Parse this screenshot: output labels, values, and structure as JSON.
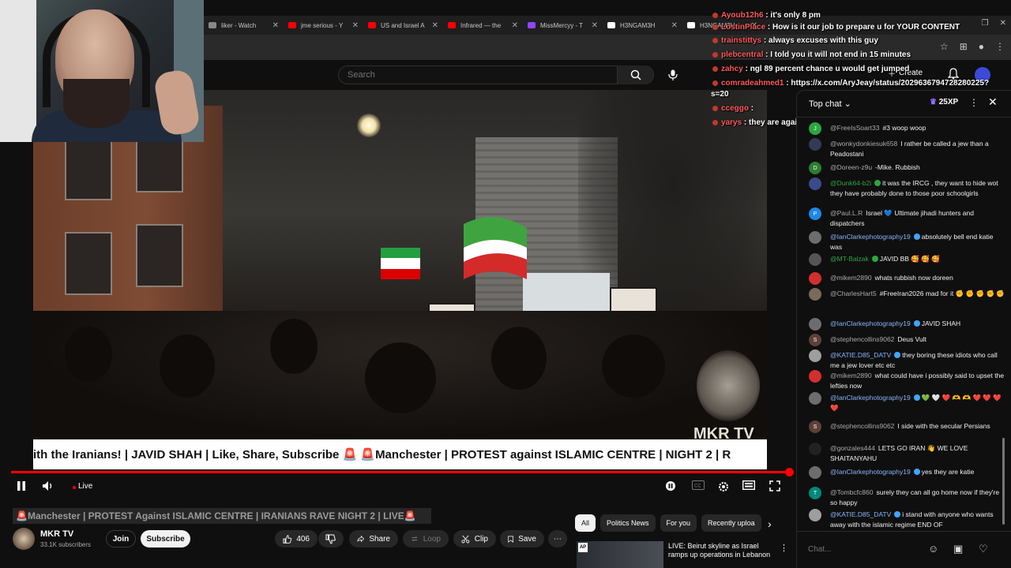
{
  "browser": {
    "tabs": [
      {
        "label": "liker - Watch",
        "color": "#888888"
      },
      {
        "label": "jme serious - Y",
        "color": "#ff0000"
      },
      {
        "label": "US and Israel A",
        "color": "#ff0000"
      },
      {
        "label": "Infrared — the",
        "color": "#ff0000"
      },
      {
        "label": "MissMercyy - T",
        "color": "#9146ff"
      },
      {
        "label": "H3NGAM3H",
        "color": "#ffffff"
      },
      {
        "label": "H3NGAM3H",
        "color": "#ffffff"
      }
    ]
  },
  "youtube": {
    "search_placeholder": "Search",
    "create_label": "Create"
  },
  "overlay_chat": [
    {
      "user": "Ayoub12h6",
      "msg": "it's only 8 pm"
    },
    {
      "user": "LostinPlace",
      "msg": "How is it our job to prepare u for YOUR CONTENT"
    },
    {
      "user": "trainstittys",
      "msg": "always excuses with this guy"
    },
    {
      "user": "plebcentral",
      "msg": "I told you it will not end in 15 minutes"
    },
    {
      "user": "zahcy",
      "msg": "ngl 89 percent chance u would get jumped"
    },
    {
      "user": "comradeahmed1",
      "msg": "https://x.com/AryJeay/status/2029636794728280225?"
    },
    {
      "user": "",
      "msg": "s=20"
    },
    {
      "user": "cceggo",
      "msg": ""
    },
    {
      "user": "yarys",
      "msg": "they are against Irans regime and Khameni"
    }
  ],
  "video": {
    "ticker": "ith the Iranians! | JAVID SHAH | Like, Share, Subscribe 🚨  🚨Manchester | PROTEST against ISLAMIC CENTRE | NIGHT 2 | R",
    "watermark": "MKR TV",
    "live_label": "Live",
    "progress": 1.0,
    "title": "🚨Manchester | PROTEST Against ISLAMIC CENTRE | IRANIANS RAVE NIGHT 2 | LIVE🚨"
  },
  "channel": {
    "name": "MKR TV",
    "subscribers": "33.1K subscribers",
    "join_label": "Join",
    "subscribe_label": "Subscribe"
  },
  "actions": {
    "likes": "406",
    "share": "Share",
    "loop": "Loop",
    "clip": "Clip",
    "save": "Save"
  },
  "chips": [
    "All",
    "Politics News",
    "For you",
    "Recently uploa"
  ],
  "recommendation": {
    "title": "LIVE: Beirut skyline as Israel ramps up operations in Lebanon",
    "badge": "AP"
  },
  "live_chat": {
    "title": "Top chat",
    "xp": "25XP",
    "input_placeholder": "Chat...",
    "messages": [
      {
        "author": "@FreeIsSoart33",
        "text": "#3  woop woop",
        "avatar": "#2ba640",
        "initial": "J",
        "type": "normal"
      },
      {
        "author": "@wonkydonkiesuk658",
        "text": "I rather be called a jew than a Peadostani",
        "avatar": "#333a55",
        "initial": "",
        "type": "normal"
      },
      {
        "author": "@Doreen-z9u",
        "text": "-Mike. Rubbish",
        "avatar": "#2e7d32",
        "initial": "D",
        "type": "normal"
      },
      {
        "author": "@Dunk64-b2i",
        "text": "it was the IRCG , they want to hide wot they have probably done to those poor schoolgirls",
        "avatar": "#3a4a8a",
        "initial": "",
        "type": "mod"
      },
      {
        "author": "@Paul.L.R",
        "text": "Israel 💙 Ultimate jihadi hunters and dispatchers",
        "avatar": "#1e88e5",
        "initial": "P",
        "type": "normal"
      },
      {
        "author": "@IanClarkephotography19",
        "text": "absolutely bell end katie was",
        "avatar": "#6d6d6d",
        "initial": "",
        "type": "member"
      },
      {
        "author": "@MT-Balzak",
        "text": "JAVID BB 🥰 🥰 🥰",
        "avatar": "#555555",
        "initial": "",
        "type": "mod"
      },
      {
        "author": "@mikem2890",
        "text": "whats rubbish now doreen",
        "avatar": "#d32f2f",
        "initial": "",
        "type": "normal"
      },
      {
        "author": "@CharlesHart5",
        "text": "#FreeIran2026 mad for it ✊ ✊ ✊ ✊ ✊",
        "avatar": "#7a6a5a",
        "initial": "",
        "type": "normal"
      },
      {
        "author": "@IanClarkephotography19",
        "text": "JAVID SHAH",
        "avatar": "#6d6d6d",
        "initial": "",
        "type": "member"
      },
      {
        "author": "@stephencollins9062",
        "text": "Deus Vult",
        "avatar": "#5d4037",
        "initial": "S",
        "type": "normal"
      },
      {
        "author": "@KATIE.D85_DATV",
        "text": "they boring these idiots who call me a jew lover etc etc",
        "avatar": "#9e9e9e",
        "initial": "",
        "type": "member"
      },
      {
        "author": "@mikem2890",
        "text": "what could have i possibly said to upset the lefties now",
        "avatar": "#d32f2f",
        "initial": "",
        "type": "normal"
      },
      {
        "author": "@IanClarkephotography19",
        "text": "💚 🤍 ❤️ 🫶 🫶 ❤️ ❤️ ❤️ ❤️",
        "avatar": "#6d6d6d",
        "initial": "",
        "type": "member"
      },
      {
        "author": "@stephencollins9062",
        "text": "I side with the secular Persians",
        "avatar": "#5d4037",
        "initial": "S",
        "type": "normal"
      },
      {
        "author": "@gonzales444",
        "text": "LETS GO IRAN 👋 WE LOVE SHAITANYAHU",
        "avatar": "#222222",
        "initial": "",
        "type": "normal"
      },
      {
        "author": "@IanClarkephotography19",
        "text": "yes they are katie",
        "avatar": "#6d6d6d",
        "initial": "",
        "type": "member"
      },
      {
        "author": "@Tombcfc860",
        "text": "surely they can all go home now if they're so happy",
        "avatar": "#00897b",
        "initial": "T",
        "type": "normal"
      },
      {
        "author": "@KATIE.D85_DATV",
        "text": "i stand with anyone who wants away with the islamic regime END OF",
        "avatar": "#9e9e9e",
        "initial": "",
        "type": "member"
      }
    ]
  }
}
